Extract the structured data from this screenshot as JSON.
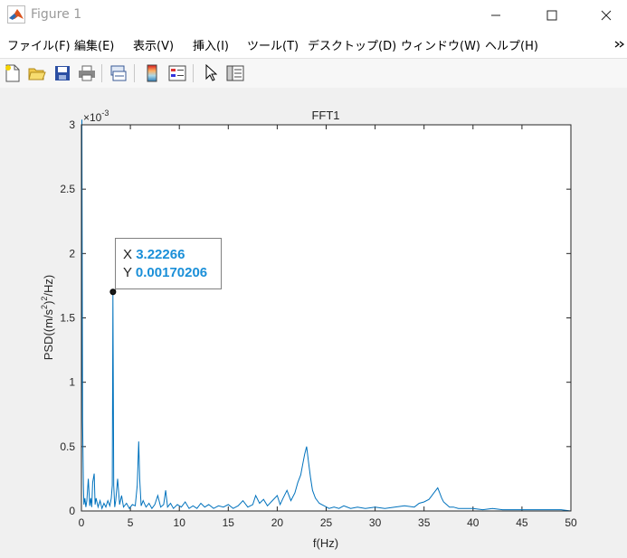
{
  "window": {
    "title": "Figure 1"
  },
  "menu": [
    "ファイル(F)",
    "編集(E)",
    "表示(V)",
    "挿入(I)",
    "ツール(T)",
    "デスクトップ(D)",
    "ウィンドウ(W)",
    "ヘルプ(H)"
  ],
  "toolbar": [
    "new-figure",
    "open-file",
    "save-figure",
    "print-figure",
    "link-plot",
    "insert-colorbar",
    "insert-legend",
    "edit-plot",
    "property-inspector"
  ],
  "colors": {
    "line": "#0072bd",
    "tip": "#1a8fd8"
  },
  "datatip": {
    "x_label": "X",
    "x_value": "3.22266",
    "y_label": "Y",
    "y_value": "0.00170206"
  },
  "chart_data": {
    "type": "line",
    "title": "FFT1",
    "xlabel": "f(Hz)",
    "ylabel": "PSD((m/s²)²/Hz)",
    "ylabel_parts": {
      "pre": "PSD((m/s",
      "sup1": "2",
      "mid": ")",
      "sup2": "2",
      "post": "/Hz)"
    },
    "exponent_label": "×10",
    "exponent": "-3",
    "xlim": [
      0,
      50
    ],
    "ylim": [
      0,
      3
    ],
    "x_ticks": [
      "0",
      "5",
      "10",
      "15",
      "20",
      "25",
      "30",
      "35",
      "40",
      "45",
      "50"
    ],
    "y_ticks": [
      "0",
      "0.5",
      "1",
      "1.5",
      "2",
      "2.5",
      "3"
    ],
    "grid": false,
    "series": [
      {
        "x": [
          0,
          0.05,
          0.12,
          0.2,
          0.25,
          0.35,
          0.45,
          0.55,
          0.7,
          0.85,
          0.95,
          1.05,
          1.15,
          1.3,
          1.4,
          1.5,
          1.7,
          1.9,
          2.1,
          2.3,
          2.5,
          2.7,
          2.9,
          3.05,
          3.15,
          3.22,
          3.3,
          3.4,
          3.5,
          3.7,
          3.9,
          4.1,
          4.3,
          4.6,
          4.9,
          5.2,
          5.5,
          5.7,
          5.85,
          5.95,
          6.1,
          6.3,
          6.6,
          6.9,
          7.2,
          7.5,
          7.8,
          8.1,
          8.4,
          8.6,
          8.8,
          9.1,
          9.4,
          9.8,
          10.2,
          10.6,
          11,
          11.4,
          11.8,
          12.2,
          12.6,
          13,
          13.5,
          14,
          14.5,
          15,
          15.5,
          16,
          16.5,
          17,
          17.5,
          17.8,
          18.2,
          18.6,
          19,
          19.5,
          20,
          20.3,
          20.6,
          21,
          21.4,
          21.8,
          22.1,
          22.4,
          22.6,
          22.8,
          23,
          23.2,
          23.4,
          23.6,
          23.9,
          24.3,
          24.8,
          25.3,
          25.8,
          26.3,
          26.8,
          27.5,
          28.2,
          29,
          30,
          31,
          32,
          33,
          34,
          34.5,
          35,
          35.5,
          35.8,
          36,
          36.2,
          36.4,
          36.6,
          36.8,
          37,
          37.3,
          37.6,
          38,
          38.5,
          39,
          40,
          41,
          42,
          43,
          44,
          45,
          46,
          47,
          48,
          49,
          50
        ],
        "y": [
          0,
          0.00304,
          0.0007,
          0.0002,
          5e-05,
          0.0001,
          3e-05,
          8e-05,
          0.00025,
          4e-05,
          0.0001,
          3e-05,
          0.00022,
          0.00029,
          5e-05,
          0.0001,
          3e-05,
          8e-05,
          2e-05,
          6e-05,
          3e-05,
          8e-05,
          4e-05,
          0.0001,
          0.0002,
          0.0017,
          0.0002,
          3e-05,
          8e-05,
          0.00025,
          5e-05,
          0.00012,
          3e-05,
          6e-05,
          2e-05,
          5e-05,
          4e-05,
          0.0002,
          0.00054,
          0.00025,
          4e-05,
          8e-05,
          3e-05,
          6e-05,
          2e-05,
          5e-05,
          0.00012,
          3e-05,
          5e-05,
          0.00016,
          3e-05,
          6e-05,
          2e-05,
          5e-05,
          3e-05,
          7e-05,
          2e-05,
          4e-05,
          2e-05,
          6e-05,
          3e-05,
          5e-05,
          2e-05,
          4e-05,
          3e-05,
          5e-05,
          2e-05,
          4e-05,
          8e-05,
          3e-05,
          5e-05,
          0.00012,
          6e-05,
          9e-05,
          4e-05,
          8e-05,
          0.00012,
          5e-05,
          0.0001,
          0.00016,
          8e-05,
          0.00014,
          0.00022,
          0.00028,
          0.00036,
          0.00044,
          0.0005,
          0.00038,
          0.00026,
          0.00016,
          0.0001,
          6e-05,
          4e-05,
          2e-05,
          3e-05,
          2e-05,
          4e-05,
          2e-05,
          3e-05,
          2e-05,
          3e-05,
          2e-05,
          3e-05,
          4e-05,
          3e-05,
          6e-05,
          7e-05,
          9e-05,
          0.00012,
          0.00014,
          0.00016,
          0.00018,
          0.00014,
          0.0001,
          7e-05,
          5e-05,
          3e-05,
          3e-05,
          2e-05,
          2e-05,
          2e-05,
          1e-05,
          2e-05,
          1e-05,
          1e-05,
          1e-05,
          1e-05,
          1e-05,
          1e-05,
          1e-05,
          0
        ]
      }
    ],
    "datatip_point": {
      "x": 3.22266,
      "y": 0.00170206
    }
  }
}
